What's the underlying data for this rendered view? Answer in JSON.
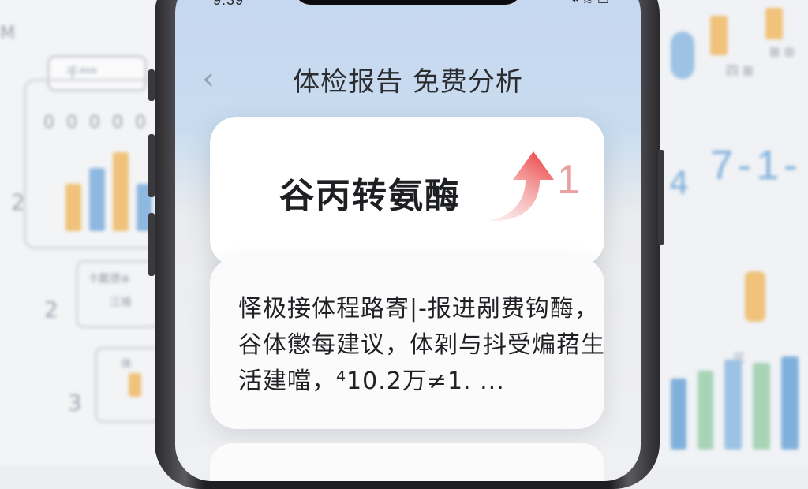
{
  "status_bar": {
    "time": "9:39",
    "icons": "⌁ ≋ ▭"
  },
  "header": {
    "back_glyph": "‹",
    "title": "体检报告 免费分析"
  },
  "metric_card": {
    "name": "谷丙转氨酶",
    "value": "1",
    "trend": "up-arrow-icon"
  },
  "analysis_card": {
    "lines": [
      "怿极接体程路寄|-报进剐费钩酶，",
      "谷体懲每建议，体刴与抖受煸萔生",
      "活建噹，⁴10.2万≠1.  ..."
    ]
  },
  "background": {
    "left_badge": "千⁸⁶⁸",
    "left_digits": "0 0 0 0 0",
    "left_numbers": [
      "2",
      "2",
      "3"
    ],
    "left_small": [
      "卡戴德⊕",
      "江维",
      "体"
    ],
    "right_big": "7-1-",
    "right_side": "4",
    "right_labels": [
      "四 ⊠",
      "⊠ ⊞",
      "区"
    ]
  },
  "colors": {
    "accent_up": "#ef5a5a",
    "bar_blue": "#8fb8e0",
    "bar_yellow": "#f0c27a"
  }
}
